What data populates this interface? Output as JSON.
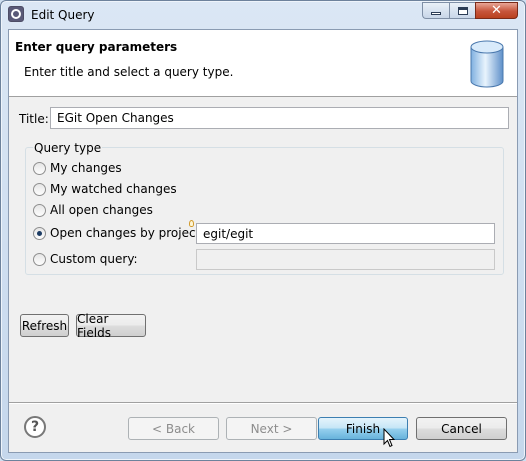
{
  "window": {
    "title": "Edit Query"
  },
  "banner": {
    "title": "Enter query parameters",
    "description": "Enter title and select a query type."
  },
  "form": {
    "title_label": "Title:",
    "title_value": "EGit Open Changes",
    "group_label": "Query type",
    "options": [
      {
        "label": "My changes",
        "checked": false
      },
      {
        "label": "My watched changes",
        "checked": false
      },
      {
        "label": "All open changes",
        "checked": false
      },
      {
        "label": "Open changes by project:",
        "checked": true
      },
      {
        "label": "Custom query:",
        "checked": false
      }
    ],
    "project_value": "egit/egit",
    "custom_value": ""
  },
  "buttons": {
    "refresh": "Refresh",
    "clear_fields": "Clear Fields",
    "back": "< Back",
    "next": "Next >",
    "finish": "Finish",
    "cancel": "Cancel"
  },
  "colors": {
    "default_button": "#98d1ef",
    "close_button": "#c7553b"
  }
}
